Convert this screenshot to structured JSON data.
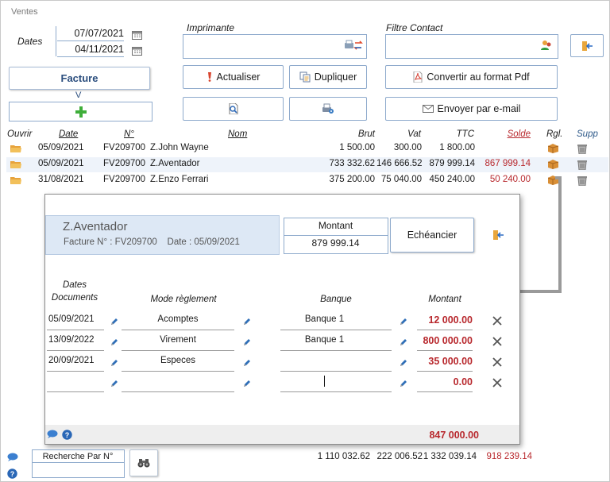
{
  "window": {
    "title": "Ventes"
  },
  "dates": {
    "label": "Dates",
    "start": "07/07/2021",
    "end": "04/11/2021"
  },
  "printer": {
    "label": "Imprimante",
    "value": ""
  },
  "contact_filter": {
    "label": "Filtre  Contact",
    "value": ""
  },
  "doc_type": {
    "selected": "Facture",
    "chevron": "V"
  },
  "toolbar": {
    "refresh_label": "Actualiser",
    "duplicate_label": "Dupliquer",
    "pdf_label": "Convertir au format Pdf",
    "email_label": "Envoyer par e-mail"
  },
  "table": {
    "headers": {
      "open": "Ouvrir",
      "date": "Date",
      "num": "N°",
      "name": "Nom",
      "brut": "Brut",
      "vat": "Vat",
      "ttc": "TTC",
      "solde": "Solde",
      "rgl": "Rgl.",
      "supp": "Supp"
    },
    "rows": [
      {
        "date": "05/09/2021",
        "num": "FV209700",
        "name": "Z.John Wayne",
        "brut": "1 500.00",
        "vat": "300.00",
        "ttc": "1 800.00",
        "solde": ""
      },
      {
        "date": "05/09/2021",
        "num": "FV209700",
        "name": "Z.Aventador",
        "brut": "733 332.62",
        "vat": "146 666.52",
        "ttc": "879 999.14",
        "solde": "867 999.14"
      },
      {
        "date": "31/08/2021",
        "num": "FV209700",
        "name": "Z.Enzo Ferrari",
        "brut": "375 200.00",
        "vat": "75 040.00",
        "ttc": "450 240.00",
        "solde": "50 240.00"
      }
    ]
  },
  "payment_popup": {
    "client_name": "Z.Aventador",
    "invoice_line": "Facture N° : FV209700    Date : 05/09/2021",
    "montant_label": "Montant",
    "montant_value": "879 999.14",
    "schedule_button": "Echéancier",
    "headers": {
      "dates": "Dates",
      "documents": "Documents",
      "mode": "Mode règlement",
      "bank": "Banque",
      "amount": "Montant"
    },
    "rows": [
      {
        "date": "05/09/2021",
        "mode": "Acomptes",
        "bank": "Banque 1",
        "amount": "12 000.00"
      },
      {
        "date": "13/09/2022",
        "mode": "Virement",
        "bank": "Banque 1",
        "amount": "800 000.00"
      },
      {
        "date": "20/09/2021",
        "mode": "Especes",
        "bank": "",
        "amount": "35 000.00"
      },
      {
        "date": "",
        "mode": "",
        "bank": "",
        "amount": "0.00"
      }
    ],
    "total": "847 000.00"
  },
  "footer": {
    "search_label": "Recherche Par N°",
    "search_value": "",
    "total_brut": "1 110 032.62",
    "total_vat": "222 006.52",
    "total_ttc": "1 332 039.14",
    "total_solde": "918 239.14"
  },
  "colors": {
    "accent_border": "#8eaacc",
    "negative_red": "#b8282d",
    "arrow_gray": "#9a9a9a",
    "panel_blue": "#dde8f5"
  }
}
